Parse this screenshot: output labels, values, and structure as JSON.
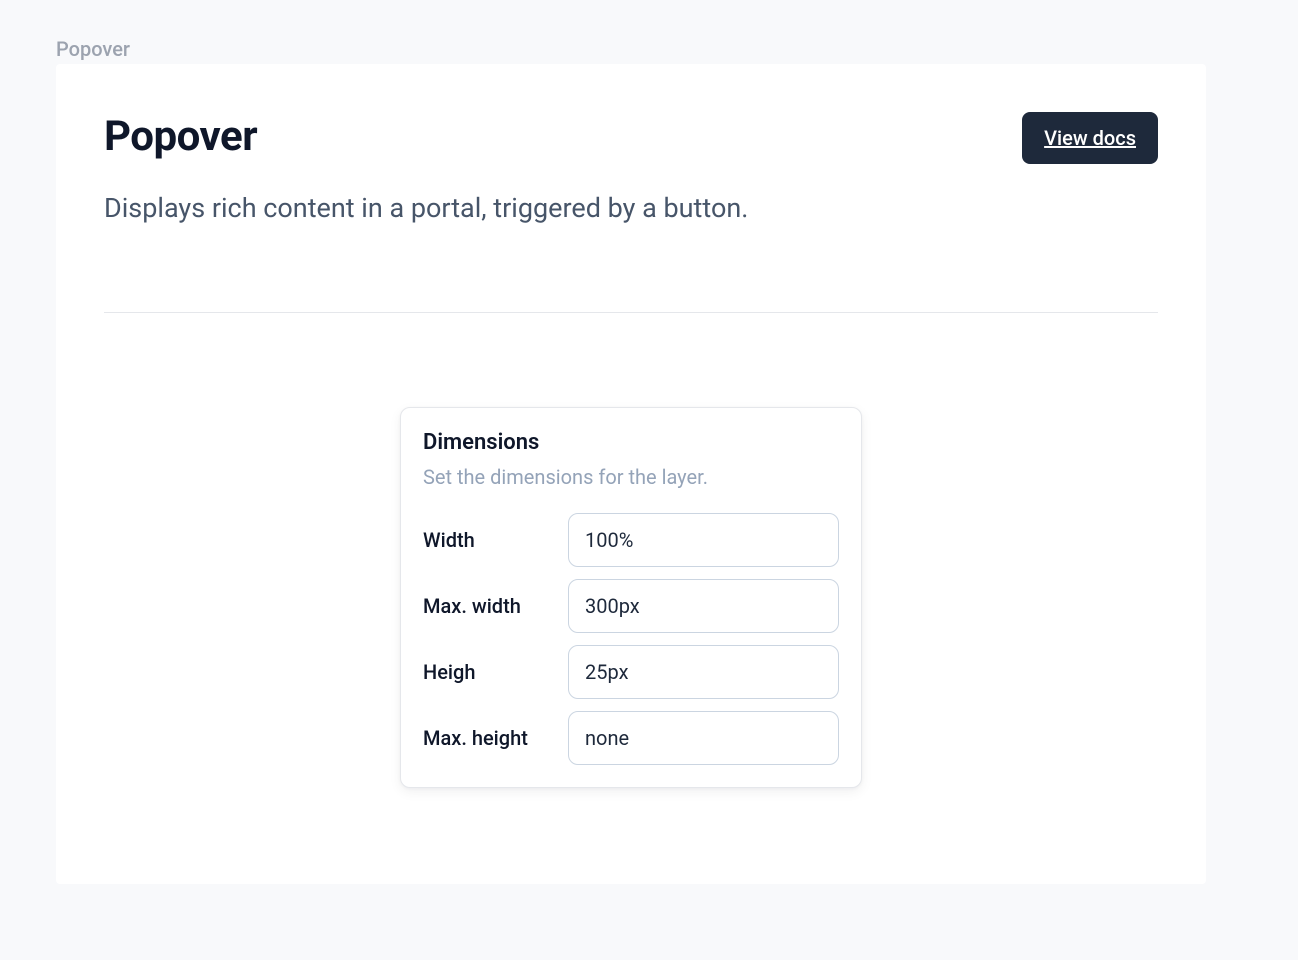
{
  "crumb": "Popover",
  "header": {
    "title": "Popover",
    "view_docs_label": "View docs",
    "description": "Displays rich content in a portal, triggered by a button."
  },
  "popover": {
    "title": "Dimensions",
    "description": "Set the dimensions for the layer.",
    "fields": [
      {
        "label": "Width",
        "value": "100%"
      },
      {
        "label": "Max. width",
        "value": "300px"
      },
      {
        "label": "Heigh",
        "value": "25px"
      },
      {
        "label": "Max. height",
        "value": "none"
      }
    ]
  }
}
